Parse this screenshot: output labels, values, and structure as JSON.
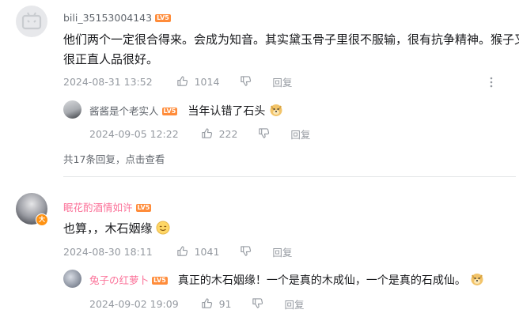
{
  "comments": [
    {
      "username": "bili_35153004143",
      "level": "LV5",
      "text_line1": "他们两个一定很合得来。会成为知音。其实黛玉骨子里很不服输，很有抗争精神。猴子又",
      "text_line2": "很正直人品很好。",
      "date": "2024-08-31 13:52",
      "likes": "1014",
      "reply_label": "回复",
      "replies": [
        {
          "username": "酱酱是个老实人",
          "level": "LV5",
          "text": "当年认错了石头",
          "date": "2024-09-05 12:22",
          "likes": "222",
          "reply_label": "回复"
        }
      ],
      "more_replies": "共17条回复，点击查看"
    },
    {
      "username": "眠花酌酒情如许",
      "level": "LV5",
      "text": "也算，，木石姻缘",
      "date": "2024-08-30 18:11",
      "likes": "1041",
      "reply_label": "回复",
      "replies": [
        {
          "username": "兔子の红萝卜",
          "level": "LV5",
          "text": "真正的木石姻缘！一个是真的木成仙，一个是真的石成仙。",
          "date": "2024-09-02 19:09",
          "likes": "91",
          "reply_label": "回复"
        }
      ]
    }
  ],
  "colors": {
    "pink_name": "#fb7299",
    "lv_pink": "#ff6699",
    "meta": "#9499a0"
  }
}
